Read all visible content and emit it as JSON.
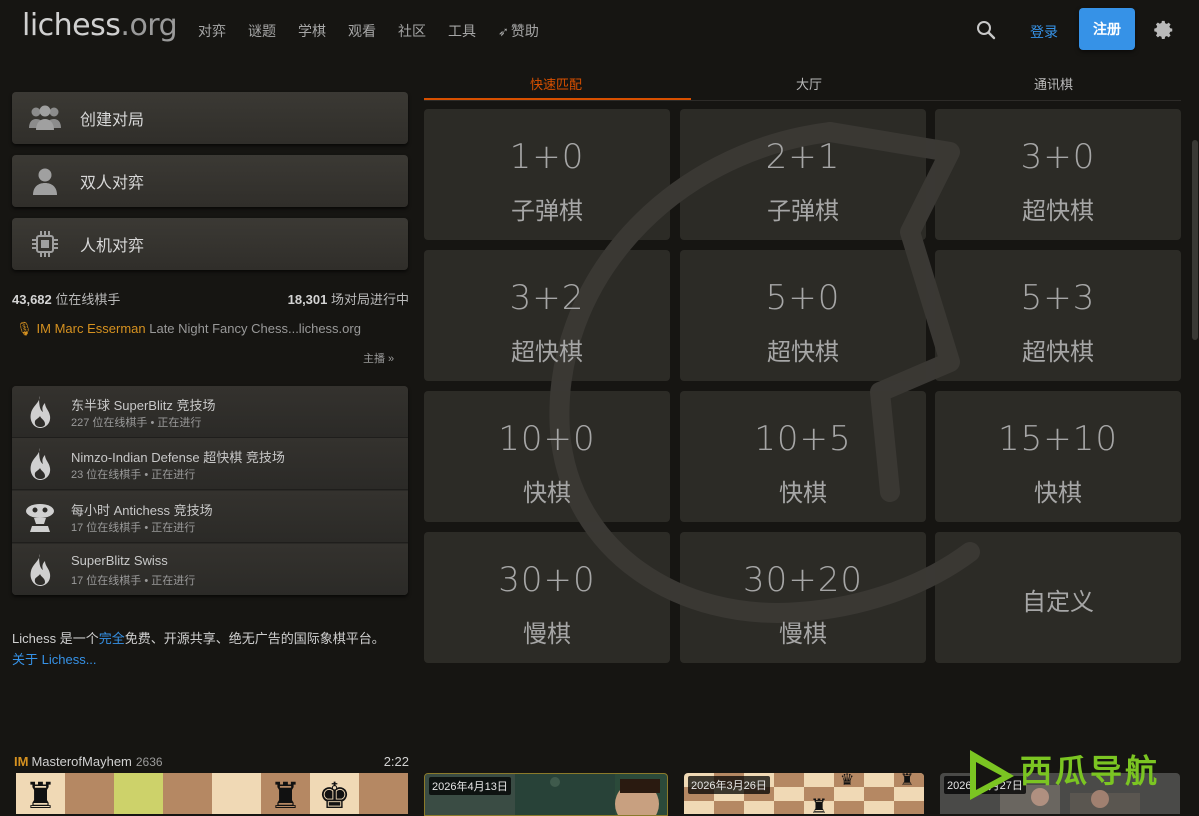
{
  "header": {
    "logo_main": "lichess",
    "logo_tld": ".org",
    "nav": [
      "对弈",
      "谜题",
      "学棋",
      "观看",
      "社区",
      "工具"
    ],
    "donate": "赞助",
    "login": "登录",
    "signup": "注册"
  },
  "left": {
    "buttons": [
      "创建对局",
      "双人对弈",
      "人机对弈"
    ],
    "online_count": "43,682",
    "online_label": " 位在线棋手",
    "games_count": "18,301",
    "games_label": " 场对局进行中",
    "stream": {
      "title": "IM",
      "name": "Marc Esserman",
      "text": " Late Night Fancy Chess...lichess.org"
    },
    "streamers_more": "主播 »",
    "tournaments": [
      {
        "name": "东半球 SuperBlitz 竞技场",
        "sub": "227 位在线棋手 • 正在进行",
        "icon": "flame-icon"
      },
      {
        "name": "Nimzo-Indian Defense 超快棋 竞技场",
        "sub": "23 位在线棋手 • 正在进行",
        "icon": "flame-icon"
      },
      {
        "name": "每小时 Antichess 竞技场",
        "sub": "17 位在线棋手 • 正在进行",
        "icon": "antichess-icon"
      },
      {
        "name": "SuperBlitz Swiss",
        "sub": "17 位在线棋手 • 正在进行",
        "icon": "flame-icon"
      }
    ],
    "about_pre": "Lichess 是一个",
    "about_link1": "完全",
    "about_mid": "免费、开源共享、绝无广告的国际象棋平台。 ",
    "about_link2": "关于 Lichess...",
    "featured": {
      "title": "IM",
      "name": "MasterofMayhem",
      "rating": "2636",
      "clock": "2:22"
    }
  },
  "center": {
    "tabs": [
      "快速匹配",
      "大厅",
      "通讯棋"
    ],
    "active_tab": "快速匹配",
    "pools": [
      {
        "clock": "1+0",
        "perf": "子弹棋"
      },
      {
        "clock": "2+1",
        "perf": "子弹棋"
      },
      {
        "clock": "3+0",
        "perf": "超快棋"
      },
      {
        "clock": "3+2",
        "perf": "超快棋"
      },
      {
        "clock": "5+0",
        "perf": "超快棋"
      },
      {
        "clock": "5+3",
        "perf": "超快棋"
      },
      {
        "clock": "10+0",
        "perf": "快棋"
      },
      {
        "clock": "10+5",
        "perf": "快棋"
      },
      {
        "clock": "15+10",
        "perf": "快棋"
      },
      {
        "clock": "30+0",
        "perf": "慢棋"
      },
      {
        "clock": "30+20",
        "perf": "慢棋"
      },
      {
        "custom": "自定义"
      }
    ]
  },
  "bottom_tiles": [
    {
      "date": "2026年4月13日"
    },
    {
      "date": "2026年3月26日"
    },
    {
      "date": "2026年2月27日"
    }
  ],
  "watermark_text": "西瓜导航",
  "colors": {
    "background": "#161512",
    "accent_orange": "#d85000",
    "link_blue": "#3692e7",
    "gold": "#d59120"
  }
}
